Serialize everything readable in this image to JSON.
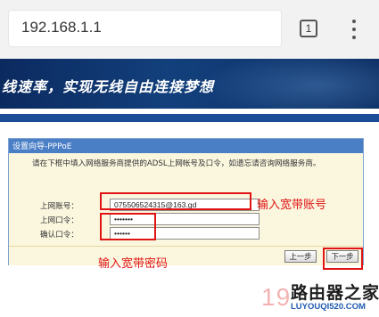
{
  "browser": {
    "url": "192.168.1.1",
    "tab_count": "1",
    "menu_icon": "vertical-ellipsis-icon"
  },
  "banner": {
    "slogan": "线速率，实现无线自由连接梦想"
  },
  "wizard": {
    "title": "设置向导-PPPoE",
    "description": "请在下框中填入网络服务商提供的ADSL上网帐号及口令，如遗忘请咨询网络服务商。",
    "fields": [
      {
        "label": "上网账号：",
        "value": "075506524315@163.gd"
      },
      {
        "label": "上网口令：",
        "value": "•••••••"
      },
      {
        "label": "确认口令：",
        "value": "••••••"
      }
    ],
    "prev_label": "上一步",
    "next_label": "下一步"
  },
  "annotations": {
    "account_note": "输入宽带账号",
    "password_note": "输入宽带密码"
  },
  "watermark": {
    "number": "191",
    "brand_cn": "路由器之家",
    "brand_url": "LUYOUQI520.COM"
  },
  "colors": {
    "annotation_red": "#e01414",
    "panel_header": "#4a7fc6",
    "panel_bg": "#fbf7df",
    "banner_blue": "#13407c"
  }
}
